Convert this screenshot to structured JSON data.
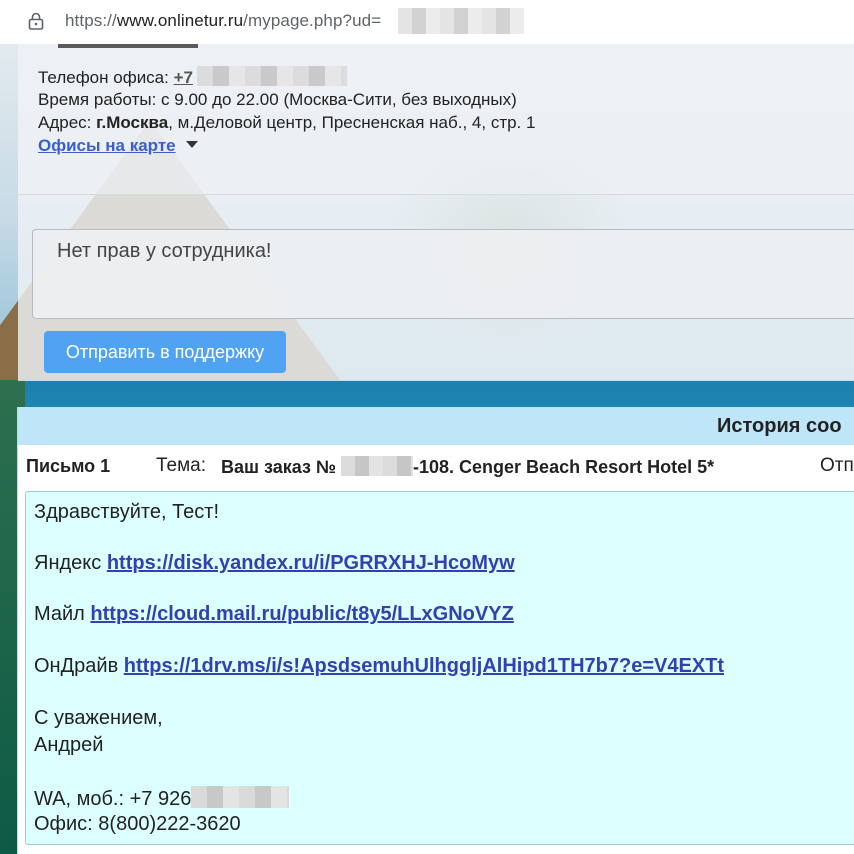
{
  "browser": {
    "url_prefix": "https://",
    "url_host": "www.onlinetur.ru",
    "url_path": "/mypage.php?ud="
  },
  "office": {
    "phone_label": "Телефон офиса:",
    "phone_prefix": "+7",
    "hours": "Время работы: с 9.00 до 22.00 (Москва-Сити, без выходных)",
    "address_label": "Адрес:",
    "address_city": "г.Москва",
    "address_rest": ", м.Деловой центр, Пресненская наб., 4, стр. 1",
    "map_link": "Офисы на карте"
  },
  "support": {
    "textarea_value": "Нет прав у сотрудника!",
    "button_label": "Отправить в поддержку"
  },
  "history": {
    "title": "История соо",
    "letter_number": "Письмо 1",
    "topic_label": "Тема:",
    "subject_prefix": "Ваш заказ №",
    "subject_suffix": "-108. Cenger Beach Resort Hotel 5*",
    "sender_label": "Отп",
    "body": {
      "greeting": "Здравствуйте, Тест!",
      "yandex_label": "Яндекс",
      "yandex_url": "https://disk.yandex.ru/i/PGRRXHJ-HcoMyw",
      "mail_label": "Майл",
      "mail_url": "https://cloud.mail.ru/public/t8y5/LLxGNoVYZ",
      "onedrive_label": "ОнДрайв",
      "onedrive_url": "https://1drv.ms/i/s!ApsdsemuhUlhggljAlHipd1TH7b7?e=V4EXTt",
      "regards": "С уважением,",
      "signature": "Андрей",
      "mobile_prefix": "WA, моб.: +7 926",
      "office_phone": "Офис: 8(800)222-3620"
    }
  }
}
